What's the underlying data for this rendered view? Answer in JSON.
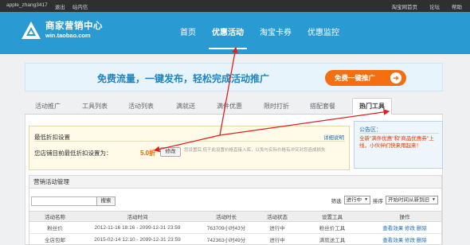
{
  "topbar": {
    "user": "apple_zhang3417",
    "separator": "，",
    "logout": "退出",
    "messages": "站内信",
    "links": [
      "淘宝网首页",
      "论坛",
      "帮助"
    ]
  },
  "header": {
    "logo_cn": "商家营销中心",
    "logo_url": "win.taobao.com",
    "nav": [
      "首页",
      "优惠活动",
      "淘宝卡券",
      "优惠监控"
    ],
    "active_nav": "优惠活动"
  },
  "banner": {
    "text": "免费流量，一键发布，轻松完成活动推广",
    "button": "免费一键推广",
    "arrow": "➜"
  },
  "tabs": [
    "活动推广",
    "工具列表",
    "活动列表",
    "满就送",
    "满件优惠",
    "限时打折",
    "搭配套餐",
    "热门工具"
  ],
  "active_tab": "热门工具",
  "discount": {
    "title": "最低折扣设置",
    "help": "详细说明",
    "label": "您店铺目前最低折扣设置为：",
    "value": "5.0折",
    "edit": "修改",
    "note": "您设置后,低于此设置价格直接入库，以免与实际价格有冲突对您造成损失"
  },
  "notice": {
    "title": "公告区：",
    "body": "全新\"满件优惠\"和\"商品优惠券\"上线，小伙伴们快来用起来！"
  },
  "mgmt": {
    "title": "营销活动管理",
    "search": "搜索",
    "filter_label": "筛选",
    "filter_value": "进行中",
    "sort_label": "排序",
    "sort_value": "开始时间从新到旧",
    "columns": [
      "活动名称",
      "活动时间",
      "活动时长",
      "活动状态",
      "设置工具",
      "操作"
    ],
    "rows": [
      {
        "name": "粉丝价",
        "time": "2012-11-16 18:16 - 2099-12-31 23:59",
        "duration": "763709小时43分",
        "status": "进行中",
        "tool": "粉丝价工具",
        "ops": [
          "查看效果",
          "修改",
          "删除"
        ]
      },
      {
        "name": "全店包邮",
        "time": "2015-02-14 12:10 - 2099-12-31 23:59",
        "duration": "742363小时49分",
        "status": "进行中",
        "tool": "满就送工具",
        "ops": [
          "查看效果",
          "修改",
          "删除"
        ]
      }
    ]
  },
  "colors": {
    "header_blue": "#2a9bd2",
    "accent_orange": "#f36f12",
    "discount_orange": "#f06000",
    "annotation_red": "#e02020"
  }
}
